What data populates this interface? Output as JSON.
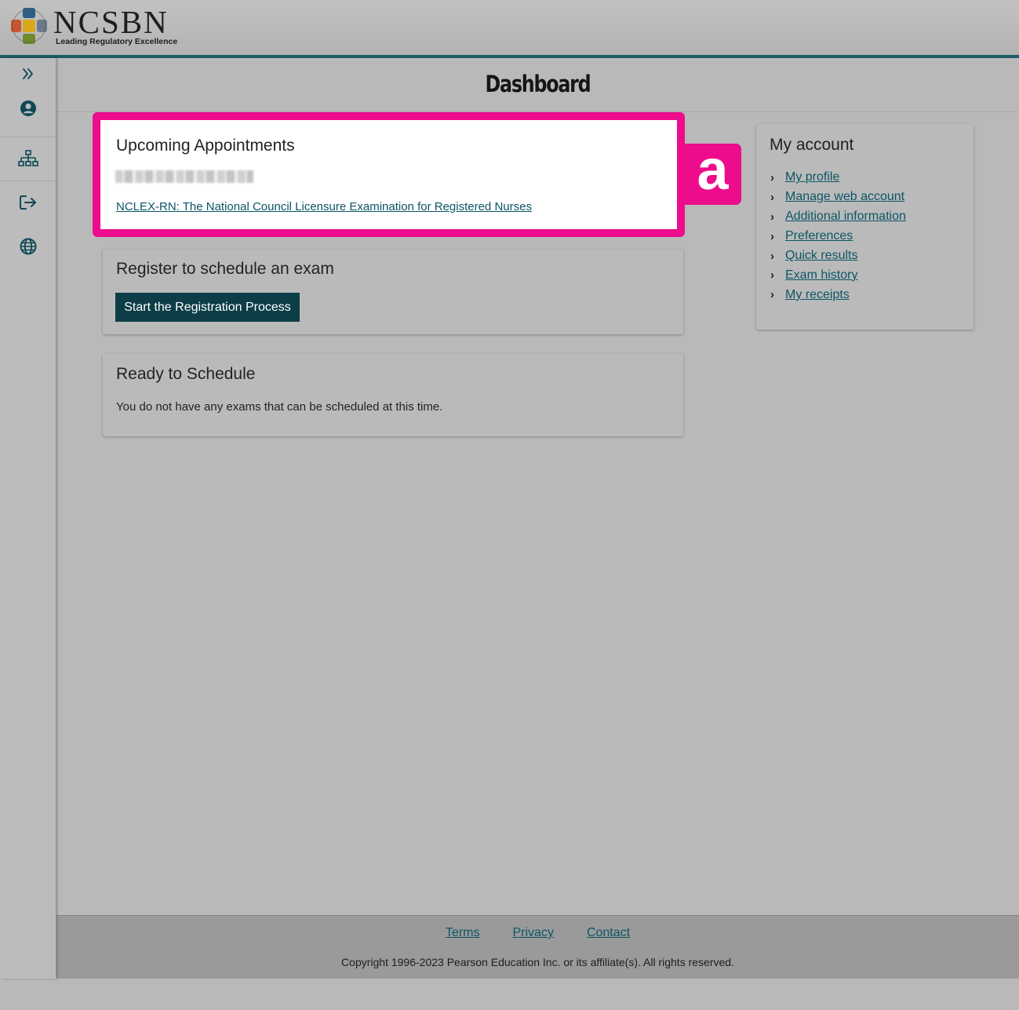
{
  "brand": {
    "name": "NCSBN",
    "tagline": "Leading Regulatory Excellence"
  },
  "rail": {
    "items": [
      {
        "icon": "expand-double-chevron-icon"
      },
      {
        "icon": "user-account-icon"
      },
      {
        "icon": "sitemap-icon"
      },
      {
        "icon": "sign-out-icon"
      },
      {
        "icon": "globe-language-icon"
      }
    ]
  },
  "page": {
    "title": "Dashboard"
  },
  "upcoming": {
    "title": "Upcoming Appointments",
    "exam_link": "NCLEX-RN: The National Council Licensure Examination for Registered Nurses",
    "annotation_label": "a"
  },
  "register": {
    "title": "Register to schedule an exam",
    "button_label": "Start the Registration Process"
  },
  "ready": {
    "title": "Ready to Schedule",
    "message": "You do not have any exams that can be scheduled at this time."
  },
  "account": {
    "title": "My account",
    "links": [
      "My profile",
      "Manage web account",
      "Additional information",
      "Preferences",
      "Quick results",
      "Exam history",
      "My receipts"
    ]
  },
  "footer": {
    "links": [
      "Terms",
      "Privacy",
      "Contact"
    ],
    "copyright": "Copyright 1996-2023 Pearson Education Inc. or its affiliate(s). All rights reserved."
  },
  "colors": {
    "accent": "#0d3e48",
    "link": "#0b5566",
    "highlight": "#ec0c8c",
    "header_rule": "#1c5a66"
  }
}
